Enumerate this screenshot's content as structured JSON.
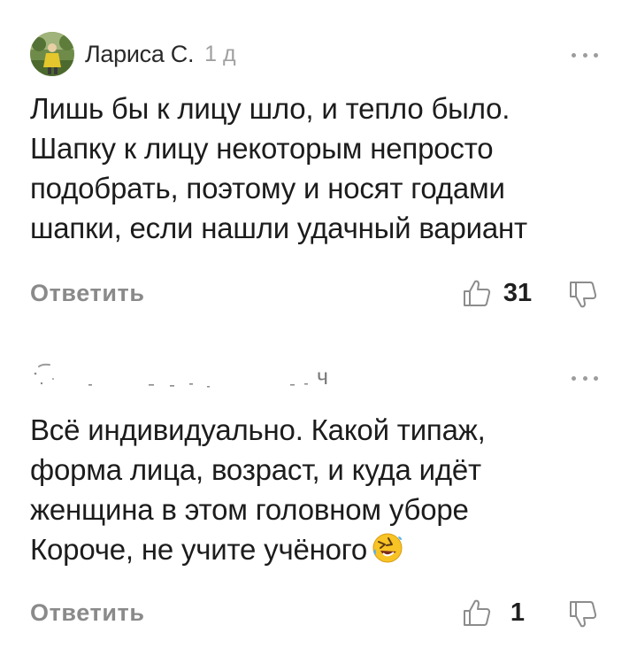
{
  "comments": [
    {
      "author": "Лариса С.",
      "time": "1 д",
      "lines": [
        "Лишь бы к лицу шло, и тепло было.",
        "Шапку к лицу некоторым непросто",
        "подобрать, поэтому и носят годами",
        "шапки, если нашли удачный вариант"
      ],
      "reply_label": "Ответить",
      "likes": "31"
    },
    {
      "author": "",
      "time": "ч",
      "lines": [
        "Всё индивидуально. Какой типаж,",
        "форма лица, возраст, и куда идёт",
        "женщина в этом головном уборе",
        "Короче, не учите учёного"
      ],
      "emoji": "rolling-on-floor-laughing",
      "reply_label": "Ответить",
      "likes": "1"
    }
  ],
  "colors": {
    "text": "#1c1c1c",
    "muted": "#8a8a8a",
    "time": "#a0a0a0",
    "icon": "#8c8c8c",
    "background": "#ffffff"
  },
  "icons": {
    "like": "thumbs-up-outline-icon",
    "dislike": "thumbs-down-outline-icon",
    "more": "more-dots-icon"
  }
}
